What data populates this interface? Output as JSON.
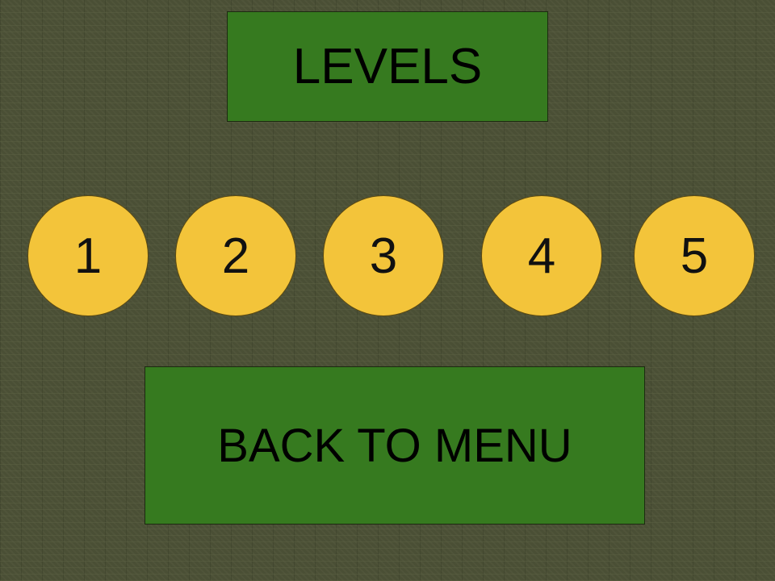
{
  "title": "LEVELS",
  "levels": [
    {
      "label": "1"
    },
    {
      "label": "2"
    },
    {
      "label": "3"
    },
    {
      "label": "4"
    },
    {
      "label": "5"
    }
  ],
  "back_button": {
    "label": "BACK TO MENU"
  },
  "colors": {
    "background": "#4a4f35",
    "panel": "#367a1f",
    "level_button": "#f3c43a",
    "text": "#000000"
  }
}
